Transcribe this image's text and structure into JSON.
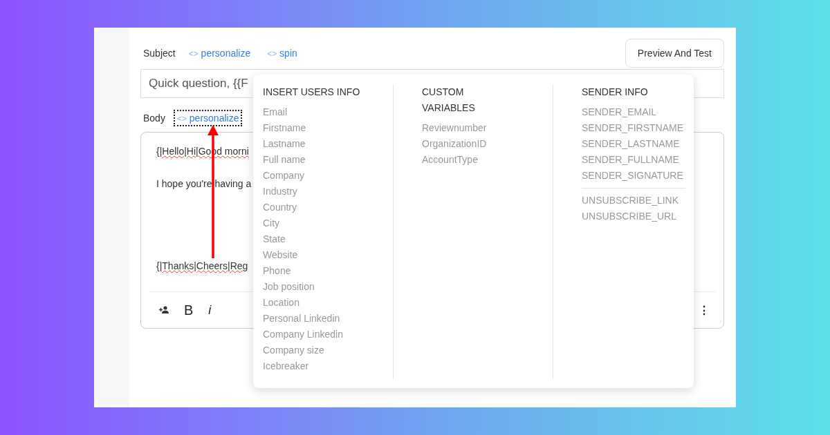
{
  "subject": {
    "label": "Subject",
    "links": [
      {
        "icon": "<>",
        "label": "personalize",
        "focused": false
      },
      {
        "icon": "<>",
        "label": "spin",
        "focused": false
      }
    ],
    "value": "Quick question, {{F"
  },
  "preview_button": "Preview And Test",
  "body": {
    "label": "Body",
    "links": [
      {
        "icon": "<>",
        "label": "personalize",
        "focused": true
      }
    ],
    "lines": [
      {
        "text": "{|Hello|Hi|Good morni",
        "misspelled": true
      },
      {
        "text": "I hope you're having a",
        "misspelled": false
      },
      {
        "text": "{|Thanks|Cheers|Reg",
        "misspelled": true
      }
    ],
    "toolbar": [
      {
        "kind": "icon"
      },
      {
        "kind": "bold",
        "label": "B"
      },
      {
        "kind": "italic",
        "label": "i"
      }
    ],
    "more": "⋮"
  },
  "popup": {
    "columns": [
      {
        "heading": "INSERT USERS INFO",
        "groups": [
          [
            "Email",
            "Firstname",
            "Lastname",
            "Full name",
            "Company",
            "Industry",
            "Country",
            "City",
            "State",
            "Website",
            "Phone",
            "Job position",
            "Location",
            "Personal Linkedin",
            "Company Linkedin",
            "Company size",
            "Icebreaker"
          ]
        ]
      },
      {
        "heading": "CUSTOM VARIABLES",
        "groups": [
          [
            "Reviewnumber",
            "OrganizationID",
            "AccountType"
          ]
        ]
      },
      {
        "heading": "SENDER INFO",
        "groups": [
          [
            "SENDER_EMAIL",
            "SENDER_FIRSTNAME",
            "SENDER_LASTNAME",
            "SENDER_FULLNAME",
            "SENDER_SIGNATURE"
          ],
          [
            "UNSUBSCRIBE_LINK",
            "UNSUBSCRIBE_URL"
          ]
        ]
      }
    ]
  }
}
